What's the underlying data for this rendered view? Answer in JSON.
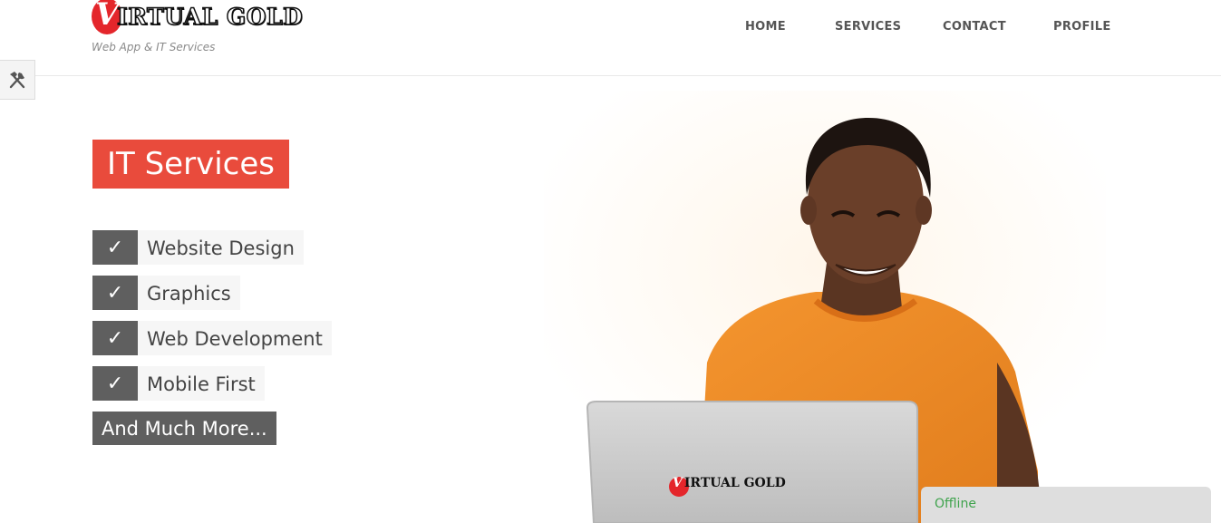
{
  "brand": {
    "logo_letter": "V",
    "logo_text": "IRTUAL GOLD",
    "tagline": "Web App & IT Services"
  },
  "nav": {
    "items": [
      "HOME",
      "SERVICES",
      "CONTACT",
      "PROFILE"
    ]
  },
  "hero": {
    "title": "IT Services",
    "services": [
      {
        "check": "✓",
        "label": "Website Design"
      },
      {
        "check": "✓",
        "label": "Graphics"
      },
      {
        "check": "✓",
        "label": "Web Development"
      },
      {
        "check": "✓",
        "label": "Mobile First"
      }
    ],
    "more_label": "And Much More..."
  },
  "laptop": {
    "logo_letter": "V",
    "logo_text": "IRTUAL GOLD"
  },
  "chat": {
    "status": "Offline"
  },
  "colors": {
    "accent": "#e94b3c",
    "check_bg": "#5f5f5f",
    "shirt": "#f08a24",
    "online_text": "#3fa34d"
  },
  "icons": {
    "tools": "tools-icon",
    "check": "check-icon"
  }
}
